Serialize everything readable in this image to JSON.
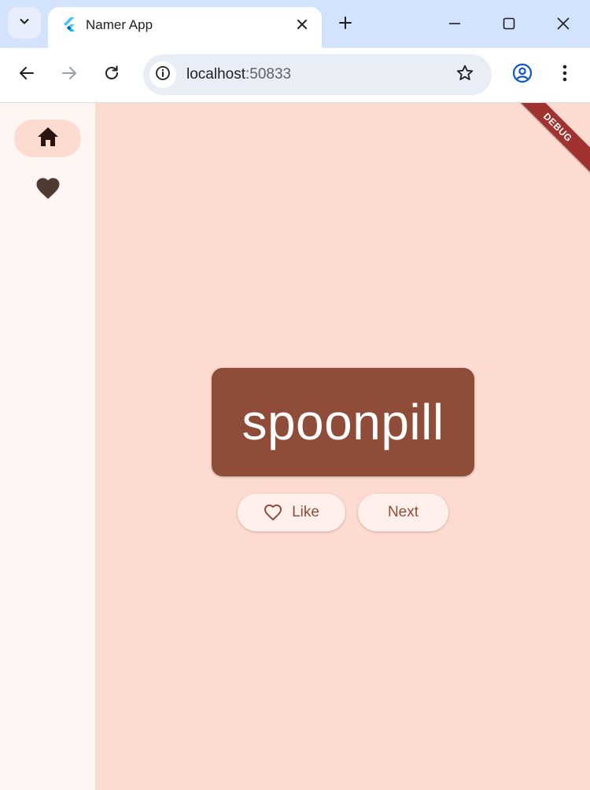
{
  "browser": {
    "tab_title": "Namer App",
    "url_host": "localhost",
    "url_port": ":50833"
  },
  "app": {
    "rail": {
      "items": [
        {
          "icon": "home-icon",
          "selected": true
        },
        {
          "icon": "favorite-icon",
          "selected": false
        }
      ]
    },
    "word": "spoonpill",
    "like_label": "Like",
    "next_label": "Next",
    "debug_label": "DEBUG",
    "colors": {
      "background": "#fedbd1",
      "rail": "#fff5f3",
      "card": "#8f4c38",
      "button_bg": "#fff0ec",
      "button_text": "#8f4c38",
      "debug_banner": "#a0332f"
    }
  }
}
